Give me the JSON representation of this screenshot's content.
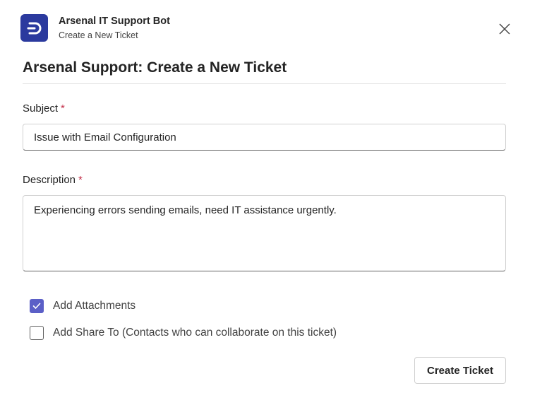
{
  "header": {
    "app_name": "Arsenal IT Support Bot",
    "subtitle": "Create a New Ticket",
    "app_icon": "arsenal-bot-logo",
    "close_icon": "close-icon",
    "accent_color": "#2b3a9e"
  },
  "form": {
    "title": "Arsenal Support: Create a New Ticket",
    "subject": {
      "label": "Subject",
      "required_mark": "*",
      "value": "Issue with Email Configuration"
    },
    "description": {
      "label": "Description",
      "required_mark": "*",
      "value": "Experiencing errors sending emails, need IT assistance urgently."
    },
    "options": [
      {
        "label": "Add Attachments",
        "checked": true
      },
      {
        "label": "Add Share To (Contacts who can collaborate on this ticket)",
        "checked": false
      }
    ],
    "checkbox_color": "#5b5fc7",
    "required_color": "#c4314b",
    "submit_label": "Create Ticket"
  }
}
